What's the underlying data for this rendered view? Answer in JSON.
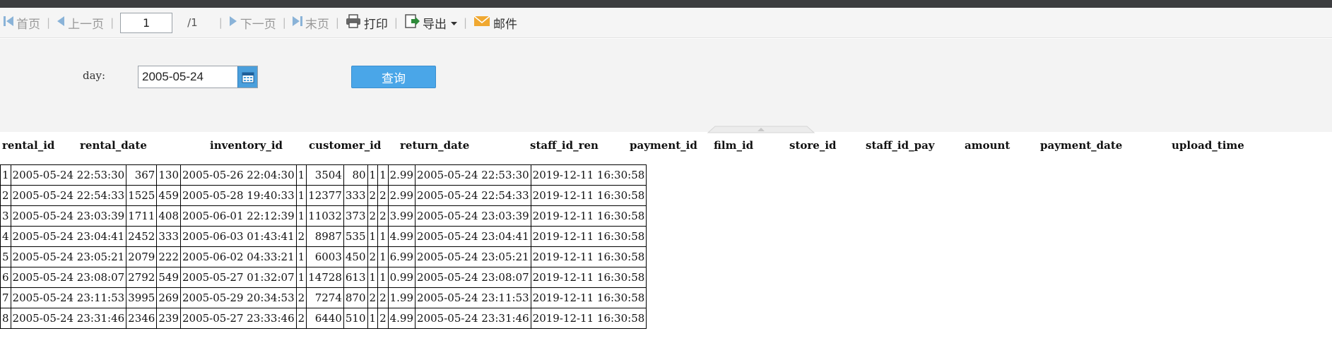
{
  "toolbar": {
    "first": "首页",
    "prev": "上一页",
    "page_value": "1",
    "page_total": "/1",
    "next": "下一页",
    "last": "末页",
    "print": "打印",
    "export": "导出",
    "mail": "邮件"
  },
  "params": {
    "day_label": "day:",
    "day_value": "2005-05-24",
    "query_label": "查询"
  },
  "table": {
    "headers": [
      "rental_id",
      "rental_date",
      "inventory_id",
      "customer_id",
      "return_date",
      "staff_id_ren",
      "payment_id",
      "film_id",
      "store_id",
      "staff_id_pay",
      "amount",
      "payment_date",
      "upload_time"
    ],
    "rows": [
      [
        "1",
        "2005-05-24 22:53:30",
        "367",
        "130",
        "2005-05-26 22:04:30",
        "1",
        "3504",
        "80",
        "1",
        "1",
        "2.99",
        "2005-05-24 22:53:30",
        "2019-12-11 16:30:58"
      ],
      [
        "2",
        "2005-05-24 22:54:33",
        "1525",
        "459",
        "2005-05-28 19:40:33",
        "1",
        "12377",
        "333",
        "2",
        "2",
        "2.99",
        "2005-05-24 22:54:33",
        "2019-12-11 16:30:58"
      ],
      [
        "3",
        "2005-05-24 23:03:39",
        "1711",
        "408",
        "2005-06-01 22:12:39",
        "1",
        "11032",
        "373",
        "2",
        "2",
        "3.99",
        "2005-05-24 23:03:39",
        "2019-12-11 16:30:58"
      ],
      [
        "4",
        "2005-05-24 23:04:41",
        "2452",
        "333",
        "2005-06-03 01:43:41",
        "2",
        "8987",
        "535",
        "1",
        "1",
        "4.99",
        "2005-05-24 23:04:41",
        "2019-12-11 16:30:58"
      ],
      [
        "5",
        "2005-05-24 23:05:21",
        "2079",
        "222",
        "2005-06-02 04:33:21",
        "1",
        "6003",
        "450",
        "2",
        "1",
        "6.99",
        "2005-05-24 23:05:21",
        "2019-12-11 16:30:58"
      ],
      [
        "6",
        "2005-05-24 23:08:07",
        "2792",
        "549",
        "2005-05-27 01:32:07",
        "1",
        "14728",
        "613",
        "1",
        "1",
        "0.99",
        "2005-05-24 23:08:07",
        "2019-12-11 16:30:58"
      ],
      [
        "7",
        "2005-05-24 23:11:53",
        "3995",
        "269",
        "2005-05-29 20:34:53",
        "2",
        "7274",
        "870",
        "2",
        "2",
        "1.99",
        "2005-05-24 23:11:53",
        "2019-12-11 16:30:58"
      ],
      [
        "8",
        "2005-05-24 23:31:46",
        "2346",
        "239",
        "2005-05-27 23:33:46",
        "2",
        "6440",
        "510",
        "1",
        "2",
        "4.99",
        "2005-05-24 23:31:46",
        "2019-12-11 16:30:58"
      ]
    ]
  },
  "colors": {
    "accent": "#4aa6e8",
    "toolbar_bg": "#f5f5f5",
    "panel_bg": "#f3f3f3",
    "mail_icon": "#f0a830",
    "export_icon": "#2e8b3a"
  },
  "icons": [
    "first-page-icon",
    "prev-page-icon",
    "next-page-icon",
    "last-page-icon",
    "print-icon",
    "export-icon",
    "dropdown-arrow-icon",
    "mail-icon",
    "calendar-icon",
    "collapse-handle-icon"
  ]
}
